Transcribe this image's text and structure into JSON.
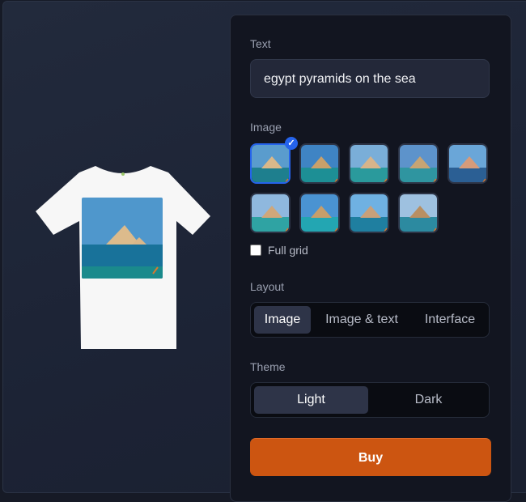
{
  "preview": {
    "product": "t-shirt",
    "shirt_color": "#f7f7f7",
    "print_image": "egypt-pyramids-on-sea-1"
  },
  "form": {
    "text_label": "Text",
    "text_value": "egypt pyramids on the sea",
    "image_label": "Image",
    "images": [
      {
        "name": "pyramids-sea-1",
        "selected": true,
        "sky": "#5a9ccd",
        "sea": "#1e7f8e",
        "pyr": "#d9b88a"
      },
      {
        "name": "pyramids-sea-2",
        "selected": false,
        "sky": "#3f84c4",
        "sea": "#1d8f95",
        "pyr": "#c9a06a"
      },
      {
        "name": "pyramids-sea-3",
        "selected": false,
        "sky": "#7aaed8",
        "sea": "#2a9a9c",
        "pyr": "#d7b48a"
      },
      {
        "name": "pyramids-sea-4",
        "selected": false,
        "sky": "#5d93cb",
        "sea": "#2f95a0",
        "pyr": "#c7a473"
      },
      {
        "name": "pyramids-sea-5",
        "selected": false,
        "sky": "#6aa6d8",
        "sea": "#2b5f94",
        "pyr": "#d79b7a"
      },
      {
        "name": "pyramids-sea-6",
        "selected": false,
        "sky": "#8fb8de",
        "sea": "#2fa3a3",
        "pyr": "#cfa77a"
      },
      {
        "name": "pyramids-sea-7",
        "selected": false,
        "sky": "#4a93d2",
        "sea": "#23a6b2",
        "pyr": "#c89e6a"
      },
      {
        "name": "pyramids-sea-8",
        "selected": false,
        "sky": "#6fb1e2",
        "sea": "#1f7fa0",
        "pyr": "#c8a07a"
      },
      {
        "name": "pyramids-sea-9",
        "selected": false,
        "sky": "#9ec1e0",
        "sea": "#2c8aa0",
        "pyr": "#b88f62"
      }
    ],
    "full_grid_label": "Full grid",
    "full_grid_checked": false,
    "layout_label": "Layout",
    "layout_options": [
      "Image",
      "Image & text",
      "Interface"
    ],
    "layout_selected": "Image",
    "theme_label": "Theme",
    "theme_options": [
      "Light",
      "Dark"
    ],
    "theme_selected": "Light",
    "buy_label": "Buy"
  },
  "colors": {
    "accent": "#2563eb",
    "buy": "#cc5511"
  }
}
